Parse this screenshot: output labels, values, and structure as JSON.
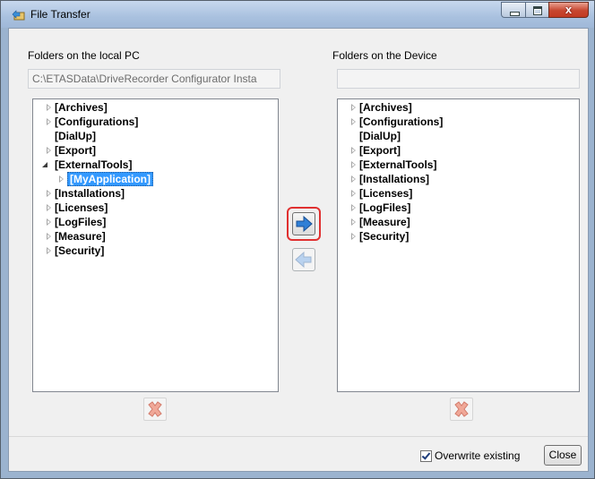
{
  "window": {
    "title": "File Transfer",
    "close_glyph": "x"
  },
  "local": {
    "label": "Folders on the local PC",
    "path": "C:\\ETASData\\DriveRecorder Configurator Insta",
    "items": [
      {
        "label": "[Archives]",
        "state": "collapsed"
      },
      {
        "label": "[Configurations]",
        "state": "collapsed"
      },
      {
        "label": "[DialUp]",
        "state": "leaf"
      },
      {
        "label": "[Export]",
        "state": "collapsed"
      },
      {
        "label": "[ExternalTools]",
        "state": "expanded"
      },
      {
        "label": "[MyApplication]",
        "state": "collapsed",
        "selected": true
      },
      {
        "label": "[Installations]",
        "state": "collapsed"
      },
      {
        "label": "[Licenses]",
        "state": "collapsed"
      },
      {
        "label": "[LogFiles]",
        "state": "collapsed"
      },
      {
        "label": "[Measure]",
        "state": "collapsed"
      },
      {
        "label": "[Security]",
        "state": "collapsed"
      }
    ]
  },
  "device": {
    "label": "Folders on the Device",
    "path": "",
    "items": [
      {
        "label": "[Archives]",
        "state": "collapsed"
      },
      {
        "label": "[Configurations]",
        "state": "collapsed"
      },
      {
        "label": "[DialUp]",
        "state": "leaf"
      },
      {
        "label": "[Export]",
        "state": "collapsed"
      },
      {
        "label": "[ExternalTools]",
        "state": "collapsed"
      },
      {
        "label": "[Installations]",
        "state": "collapsed"
      },
      {
        "label": "[Licenses]",
        "state": "collapsed"
      },
      {
        "label": "[LogFiles]",
        "state": "collapsed"
      },
      {
        "label": "[Measure]",
        "state": "collapsed"
      },
      {
        "label": "[Security]",
        "state": "collapsed"
      }
    ]
  },
  "footer": {
    "overwrite_label": "Overwrite existing",
    "overwrite_checked": true,
    "close_label": "Close"
  },
  "icons": {
    "transfer_right": "arrow-right-icon",
    "transfer_left": "arrow-left-icon",
    "delete_local": "delete-x-icon",
    "delete_device": "delete-x-icon"
  },
  "colors": {
    "arrow_blue": "#2f7fd6",
    "selection": "#3399ff",
    "highlight_ring": "#e03030",
    "delete_red": "#f0a898"
  }
}
